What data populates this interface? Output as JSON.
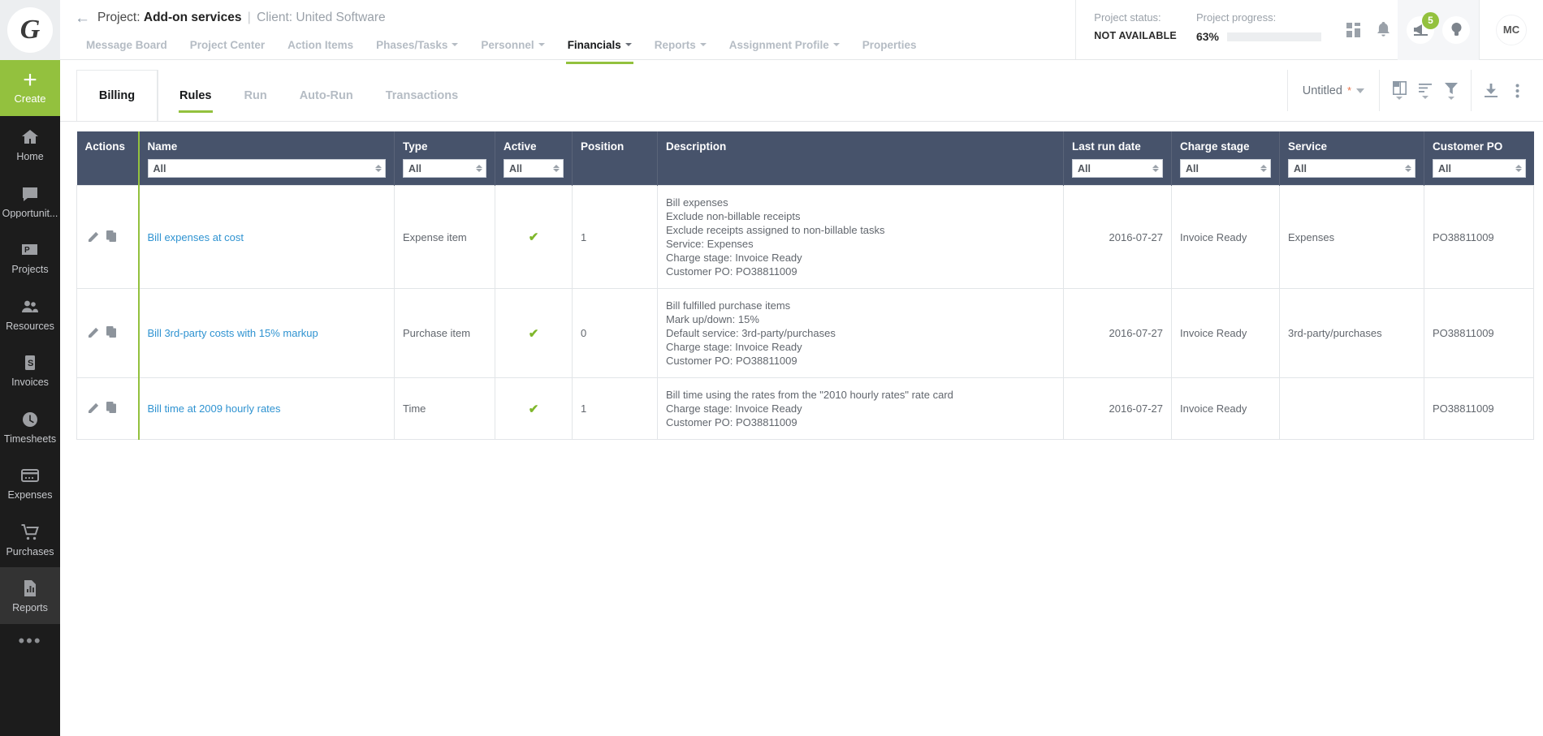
{
  "sidebar": {
    "logo_letter": "G",
    "create_label": "Create",
    "items": [
      {
        "label": "Home",
        "icon": "home-icon",
        "active": false
      },
      {
        "label": "Opportunit...",
        "icon": "speech-bubble-icon",
        "active": false
      },
      {
        "label": "Projects",
        "icon": "projects-folder-icon",
        "active": false
      },
      {
        "label": "Resources",
        "icon": "people-icon",
        "active": false
      },
      {
        "label": "Invoices",
        "icon": "invoice-dollar-icon",
        "active": false
      },
      {
        "label": "Timesheets",
        "icon": "clock-icon",
        "active": false
      },
      {
        "label": "Expenses",
        "icon": "credit-card-icon",
        "active": false
      },
      {
        "label": "Purchases",
        "icon": "shopping-cart-icon",
        "active": false
      },
      {
        "label": "Reports",
        "icon": "report-document-icon",
        "active": true
      }
    ],
    "more_label": "•••"
  },
  "header": {
    "back_icon": "back-arrow-icon",
    "project_prefix": "Project:",
    "project_name": "Add-on services",
    "separator": "|",
    "client_text": "Client: United Software",
    "nav_tabs": [
      {
        "label": "Message Board",
        "caret": false,
        "active": false
      },
      {
        "label": "Project Center",
        "caret": false,
        "active": false
      },
      {
        "label": "Action Items",
        "caret": false,
        "active": false
      },
      {
        "label": "Phases/Tasks",
        "caret": true,
        "active": false
      },
      {
        "label": "Personnel",
        "caret": true,
        "active": false
      },
      {
        "label": "Financials",
        "caret": true,
        "active": true
      },
      {
        "label": "Reports",
        "caret": true,
        "active": false
      },
      {
        "label": "Assignment Profile",
        "caret": true,
        "active": false
      },
      {
        "label": "Properties",
        "caret": false,
        "active": false
      }
    ],
    "status_label": "Project status:",
    "status_value": "NOT AVAILABLE",
    "progress_label": "Project progress:",
    "progress_pct": "63%",
    "progress_value": 63,
    "notification_count": "5",
    "avatar_initials": "MC",
    "icons": [
      {
        "name": "dashboard-widgets-icon"
      },
      {
        "name": "bell-icon"
      },
      {
        "name": "announcements-icon"
      },
      {
        "name": "lightbulb-icon"
      }
    ]
  },
  "subbar": {
    "billing_label": "Billing",
    "tabs": [
      {
        "label": "Rules",
        "active": true
      },
      {
        "label": "Run",
        "active": false
      },
      {
        "label": "Auto-Run",
        "active": false
      },
      {
        "label": "Transactions",
        "active": false
      }
    ],
    "view_name": "Untitled",
    "view_modified_marker": "*",
    "tools": [
      {
        "name": "columns-icon",
        "has_caret": true
      },
      {
        "name": "sort-icon",
        "has_caret": true
      },
      {
        "name": "filter-icon",
        "has_caret": true
      },
      {
        "name": "download-icon",
        "has_caret": false
      },
      {
        "name": "more-vertical-icon",
        "has_caret": false
      }
    ]
  },
  "table": {
    "columns": [
      {
        "key": "actions",
        "title": "Actions",
        "filter": null
      },
      {
        "key": "name",
        "title": "Name",
        "filter": "All"
      },
      {
        "key": "type",
        "title": "Type",
        "filter": "All"
      },
      {
        "key": "active",
        "title": "Active",
        "filter": "All"
      },
      {
        "key": "position",
        "title": "Position",
        "filter": null
      },
      {
        "key": "description",
        "title": "Description",
        "filter": null
      },
      {
        "key": "last_run_date",
        "title": "Last run date",
        "filter": "All"
      },
      {
        "key": "charge_stage",
        "title": "Charge stage",
        "filter": "All"
      },
      {
        "key": "service",
        "title": "Service",
        "filter": "All"
      },
      {
        "key": "customer_po",
        "title": "Customer PO",
        "filter": "All"
      }
    ],
    "row_action_icons": [
      "edit-pencil-icon",
      "copy-icon"
    ],
    "active_mark": "✔",
    "rows": [
      {
        "name": "Bill expenses at cost",
        "type": "Expense item",
        "active": true,
        "position": "1",
        "description": "Bill expenses\nExclude non-billable receipts\nExclude receipts assigned to non-billable tasks\nService: Expenses\nCharge stage: Invoice Ready\nCustomer PO: PO38811009",
        "last_run_date": "2016-07-27",
        "charge_stage": "Invoice Ready",
        "service": "Expenses",
        "customer_po": "PO38811009"
      },
      {
        "name": "Bill 3rd-party costs with 15% markup",
        "type": "Purchase item",
        "active": true,
        "position": "0",
        "description": "Bill fulfilled purchase items\nMark up/down: 15%\nDefault service: 3rd-party/purchases\nCharge stage: Invoice Ready\nCustomer PO: PO38811009",
        "last_run_date": "2016-07-27",
        "charge_stage": "Invoice Ready",
        "service": "3rd-party/purchases",
        "customer_po": "PO38811009"
      },
      {
        "name": "Bill time at 2009 hourly rates",
        "type": "Time",
        "active": true,
        "position": "1",
        "description": "Bill time using the rates from the \"2010 hourly rates\" rate card\nCharge stage: Invoice Ready\nCustomer PO: PO38811009",
        "last_run_date": "2016-07-27",
        "charge_stage": "Invoice Ready",
        "service": "",
        "customer_po": "PO38811009"
      }
    ]
  },
  "colors": {
    "accent_green": "#93c13e",
    "header_blue": "#47536b",
    "link_blue": "#2f93d1",
    "sidebar_dark": "#1c1c1c"
  }
}
